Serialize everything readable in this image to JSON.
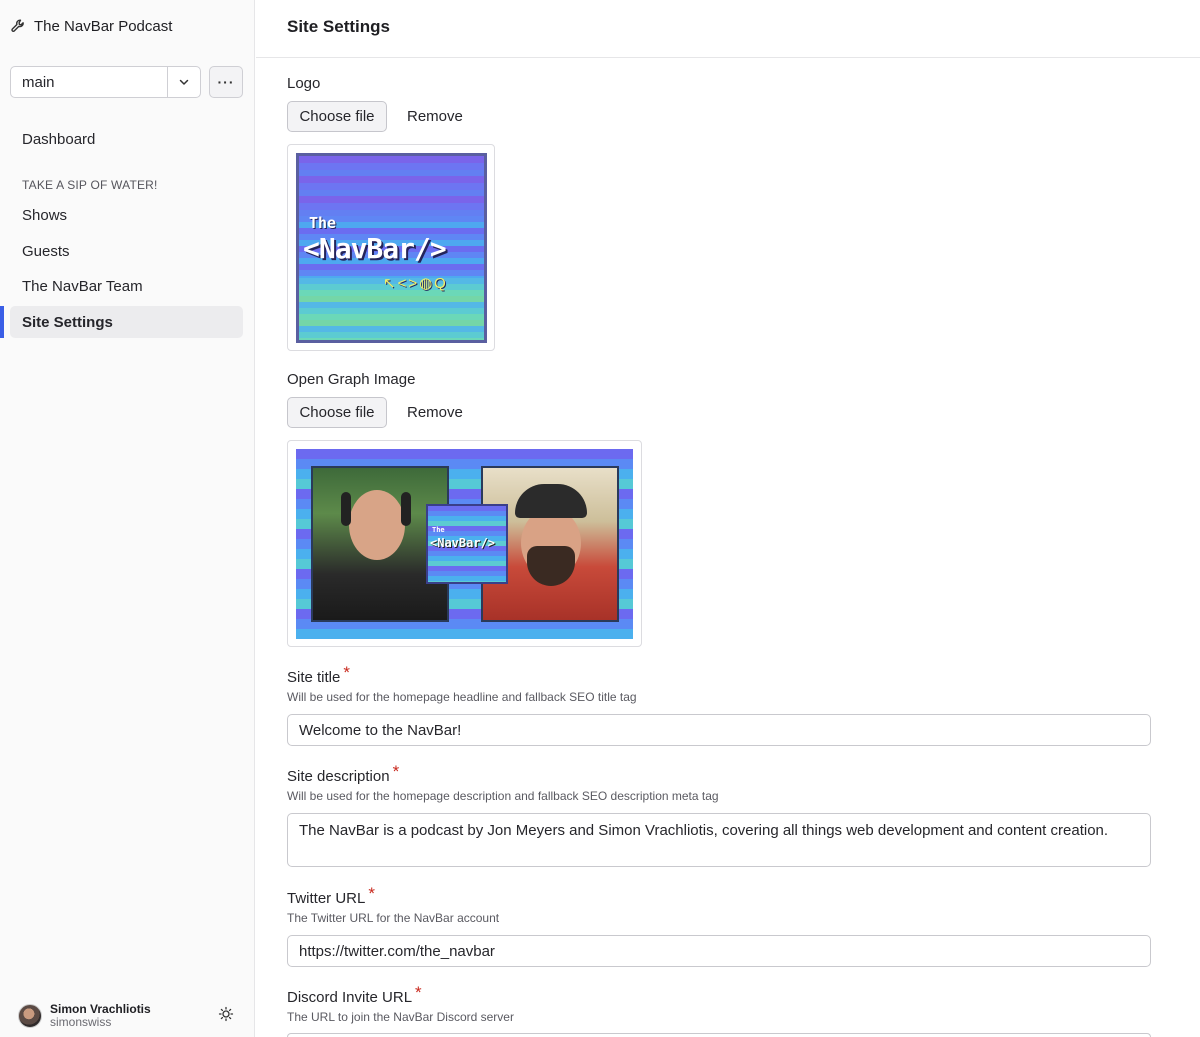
{
  "app": {
    "title": "The NavBar Podcast",
    "branch": "main"
  },
  "sidebar": {
    "items": [
      {
        "label": "Dashboard"
      },
      {
        "label": "Shows"
      },
      {
        "label": "Guests"
      },
      {
        "label": "The NavBar Team"
      },
      {
        "label": "Site Settings",
        "active": true
      }
    ],
    "section_label": "TAKE A SIP OF WATER!"
  },
  "user": {
    "name": "Simon Vrachliotis",
    "handle": "simonswiss"
  },
  "page": {
    "title": "Site Settings"
  },
  "form": {
    "logo": {
      "label": "Logo",
      "choose_label": "Choose file",
      "remove_label": "Remove",
      "image": {
        "line1": "The",
        "line2": "<NavBar/>",
        "icons": "↖<>◍Q"
      }
    },
    "og_image": {
      "label": "Open Graph Image",
      "choose_label": "Choose file",
      "remove_label": "Remove",
      "image": {
        "mini_line1": "The",
        "mini_line2": "<NavBar/>"
      }
    },
    "site_title": {
      "label": "Site title",
      "required": "*",
      "hint": "Will be used for the homepage headline and fallback SEO title tag",
      "value": "Welcome to the NavBar!"
    },
    "site_description": {
      "label": "Site description",
      "required": "*",
      "hint": "Will be used for the homepage description and fallback SEO description meta tag",
      "value": "The NavBar is a podcast by Jon Meyers and Simon Vrachliotis, covering all things web development and content creation."
    },
    "twitter_url": {
      "label": "Twitter URL",
      "required": "*",
      "hint": "The Twitter URL for the NavBar account",
      "value": "https://twitter.com/the_navbar"
    },
    "discord_url": {
      "label": "Discord Invite URL",
      "required": "*",
      "hint": "The URL to join the NavBar Discord server"
    }
  },
  "colors": {
    "accent": "#3a5ee6",
    "required": "#c8281d"
  }
}
